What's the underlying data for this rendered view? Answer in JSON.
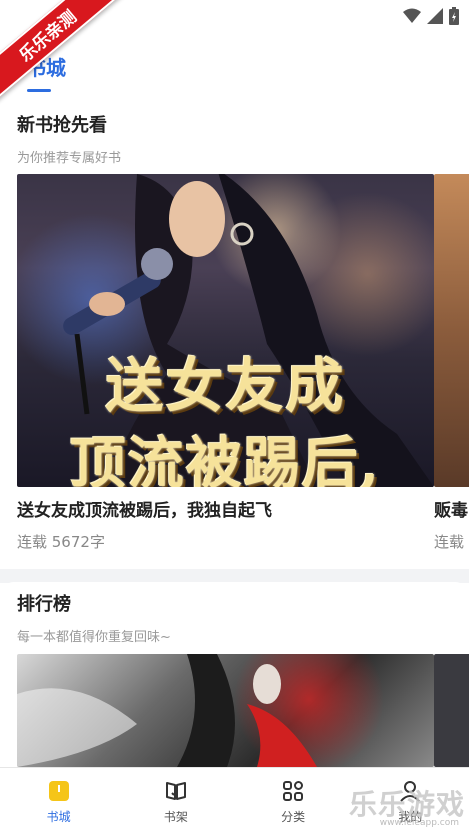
{
  "status_bar": {
    "icons": [
      "wifi-icon",
      "signal-icon",
      "battery-icon"
    ]
  },
  "header": {
    "active_tab": "书城",
    "accent": "#2d6de0"
  },
  "sections": [
    {
      "title": "新书抢先看",
      "subtitle": "为你推荐专属好书",
      "books": [
        {
          "title": "送女友成顶流被踢后，我独自起飞",
          "meta": "连载 5672字",
          "cover_text": [
            "送女友成",
            "顶流被踢后,"
          ]
        },
        {
          "title": "贩毒",
          "meta": "连载"
        }
      ]
    },
    {
      "title": "排行榜",
      "subtitle": "每一本都值得你重复回味~"
    }
  ],
  "bottom_nav": {
    "items": [
      {
        "label": "书城",
        "icon": "bookstore-icon",
        "active": true
      },
      {
        "label": "书架",
        "icon": "bookshelf-icon",
        "active": false
      },
      {
        "label": "分类",
        "icon": "category-icon",
        "active": false
      },
      {
        "label": "我的",
        "icon": "profile-icon",
        "active": false
      }
    ]
  },
  "overlay": {
    "ribbon": "乐乐亲测",
    "watermark": "乐乐游戏",
    "watermark_url": "www.leleapp.com"
  }
}
